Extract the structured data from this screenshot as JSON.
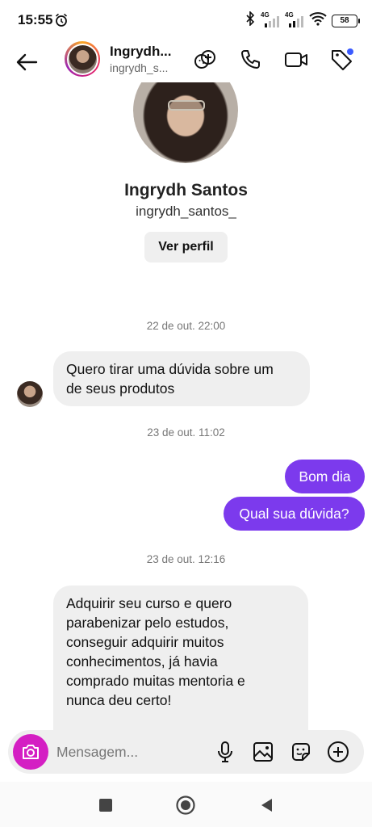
{
  "status": {
    "time": "15:55",
    "battery": "58",
    "network": "4G"
  },
  "header": {
    "name": "Ingrydh...",
    "username": "ingrydh_s...",
    "icons": [
      "back-arrow-icon",
      "effects-icon",
      "phone-icon",
      "video-icon",
      "tag-icon"
    ]
  },
  "profile": {
    "name": "Ingrydh Santos",
    "username": "ingrydh_santos_",
    "view_profile_label": "Ver perfil"
  },
  "messages": {
    "ts1": "22 de out. 22:00",
    "m1": {
      "line1": "Quero tirar uma dúvida sobre um",
      "line2": "de seus produtos"
    },
    "ts2": "23 de out. 11:02",
    "m2": "Bom dia",
    "m3": "Qual sua dúvida?",
    "ts3": "23 de out. 12:16",
    "m4": [
      "Adquirir seu curso e quero",
      "parabenizar pelo estudos,",
      "conseguir adquirir muitos",
      "conhecimentos, já havia",
      "comprado muitas mentoria e",
      "nunca deu certo!"
    ]
  },
  "composer": {
    "placeholder": "Mensagem..."
  },
  "colors": {
    "outgoing_bubble": "#7c3aed",
    "incoming_bubble": "#efefef",
    "camera_button": "#d41fc3",
    "badge_dot": "#3b5bff"
  }
}
